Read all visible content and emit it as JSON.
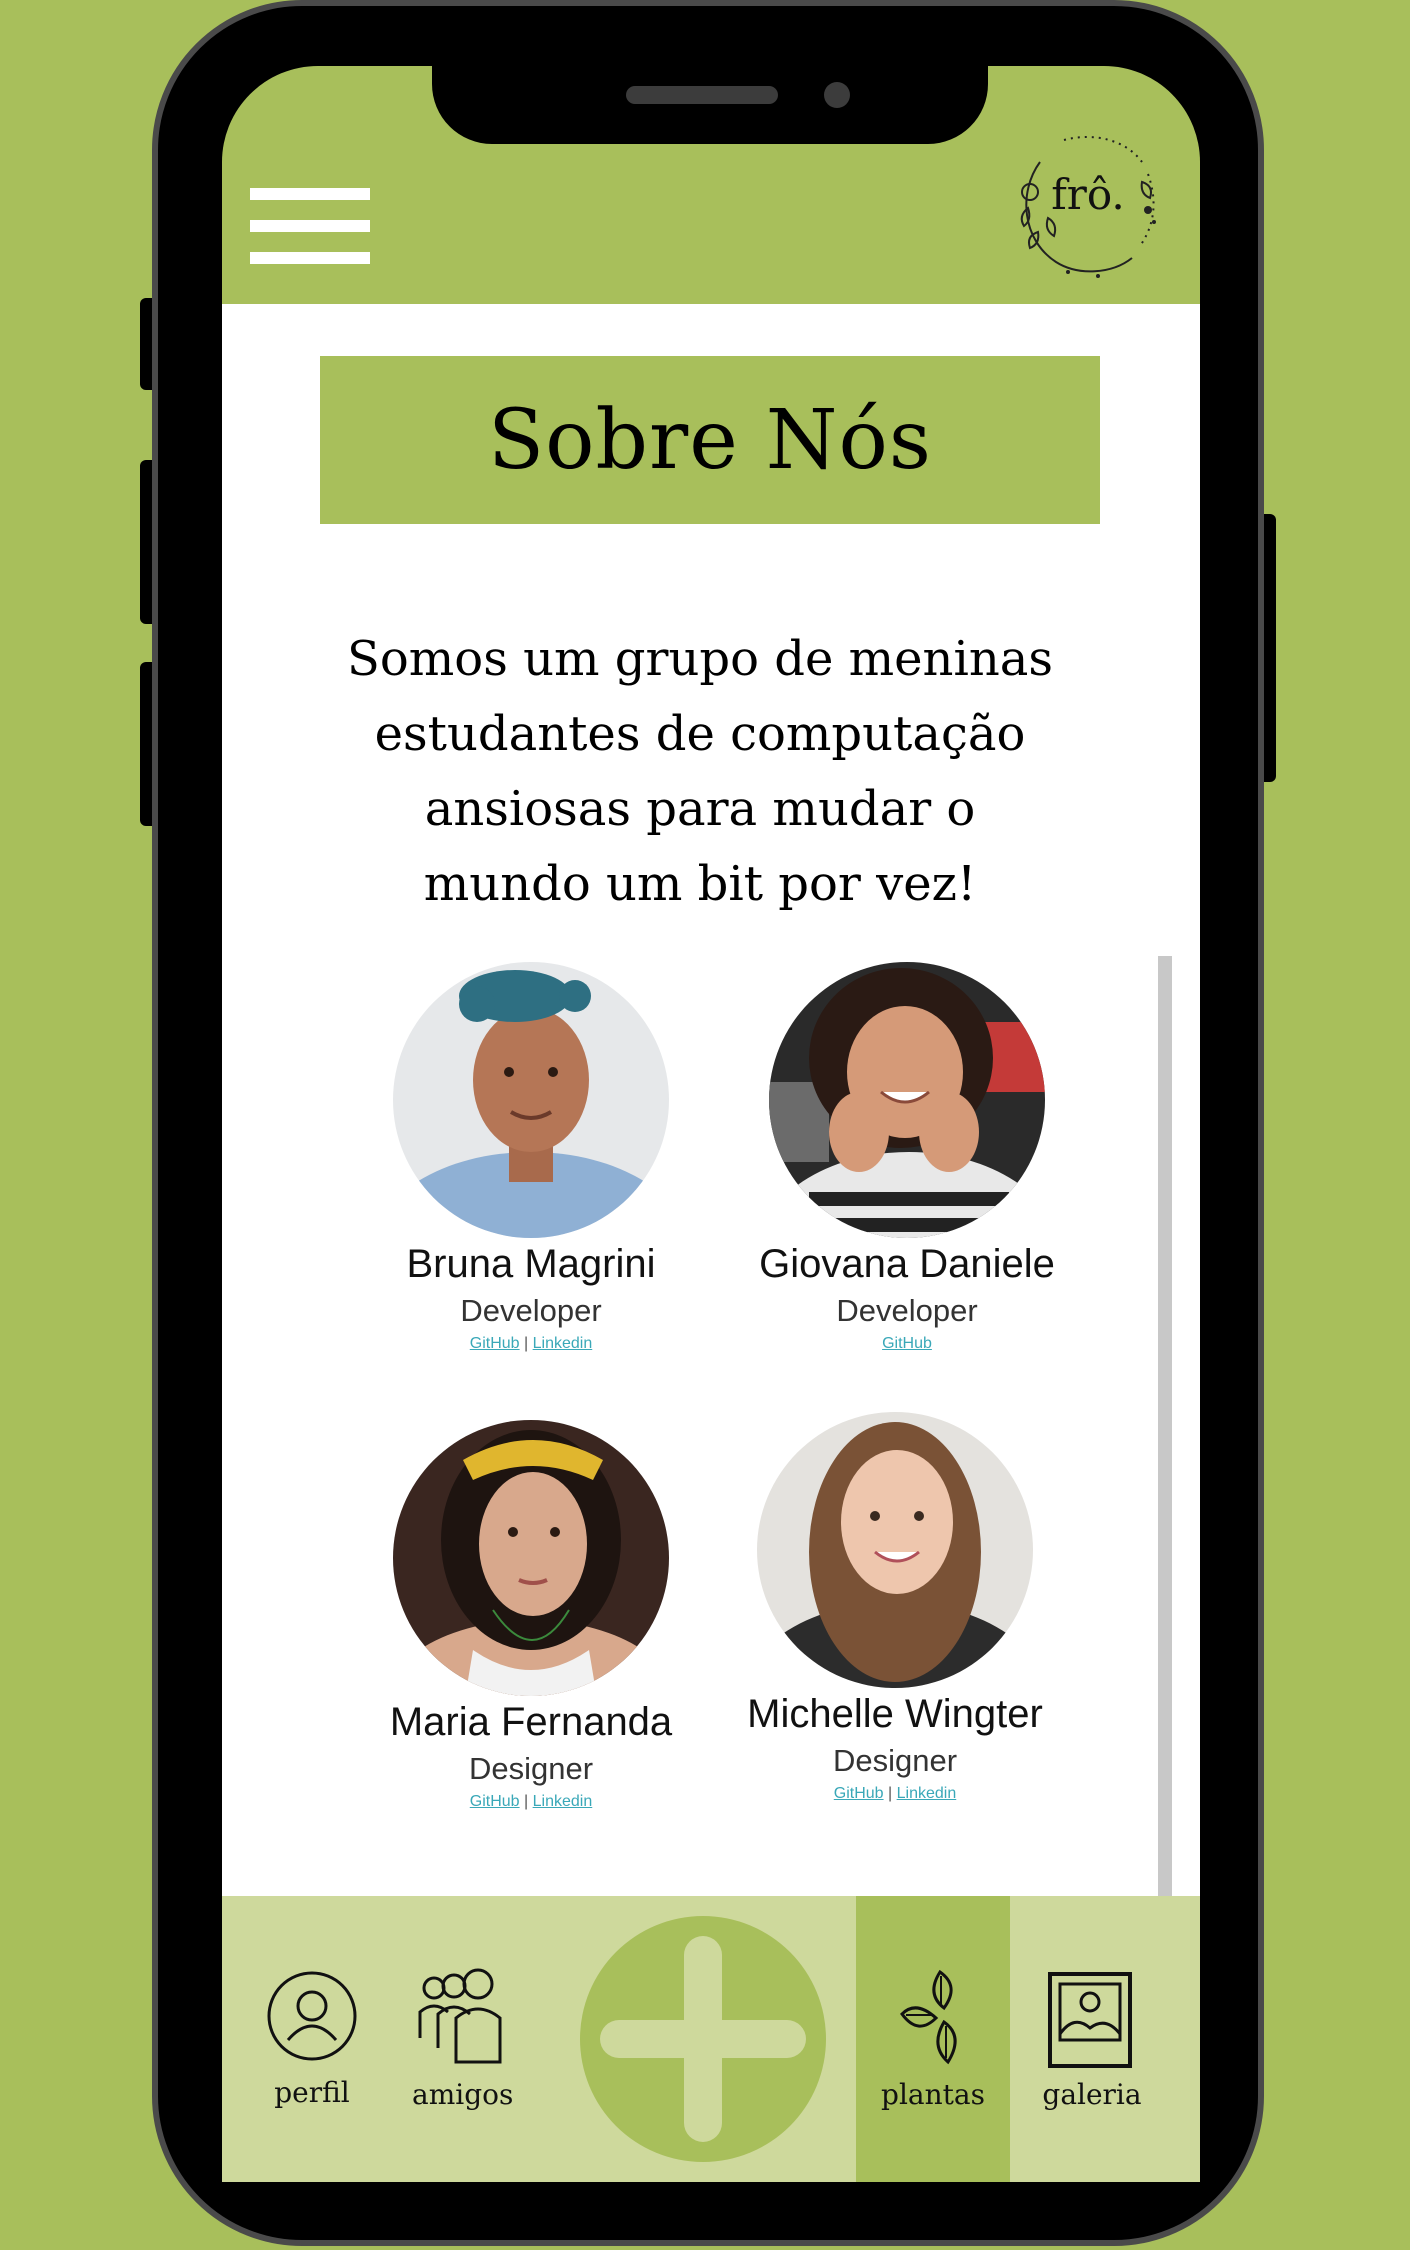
{
  "header": {
    "menu_icon": "hamburger-menu-icon",
    "logo_text": "frô."
  },
  "main": {
    "title": "Sobre Nós",
    "intro_lines": [
      "Somos um grupo de meninas",
      "estudantes de computação",
      "ansiosas para mudar o",
      "mundo um bit por vez!"
    ],
    "members": [
      {
        "name": "Bruna Magrini",
        "role": "Developer",
        "github": "GitHub",
        "separator": "|",
        "linkedin": "Linkedin"
      },
      {
        "name": "Giovana Daniele",
        "role": "Developer",
        "github": "GitHub"
      },
      {
        "name": "Maria Fernanda",
        "role": "Designer",
        "github": "GitHub",
        "separator": "|",
        "linkedin": "Linkedin"
      },
      {
        "name": "Michelle Wingter",
        "role": "Designer",
        "github": "GitHub",
        "separator": "|",
        "linkedin": "Linkedin"
      }
    ]
  },
  "tabbar": {
    "perfil": "perfil",
    "amigos": "amigos",
    "add_icon": "plus-icon",
    "plantas": "plantas",
    "galeria": "galeria",
    "active_tab": "plantas"
  },
  "colors": {
    "brand_green": "#a8bf5b",
    "light_green": "#ced99c",
    "link": "#3aa8b8"
  }
}
